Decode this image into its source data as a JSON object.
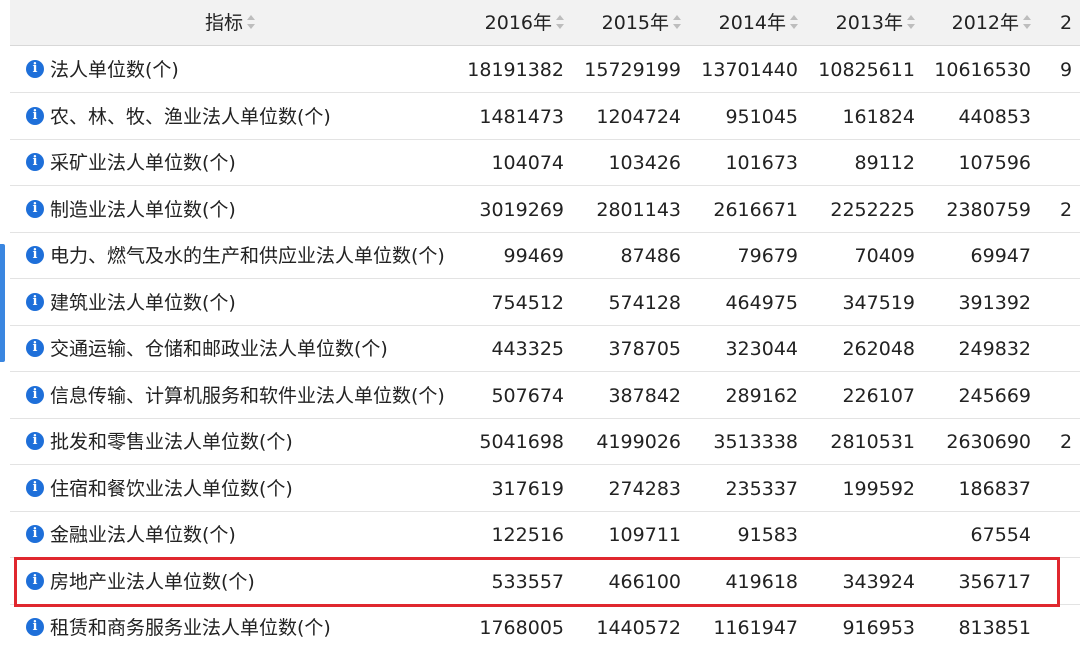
{
  "table": {
    "header": {
      "indicator": "指标",
      "years": [
        "2016年",
        "2015年",
        "2014年",
        "2013年",
        "2012年",
        "2"
      ]
    },
    "rows": [
      {
        "label": "法人单位数(个)",
        "values": [
          "18191382",
          "15729199",
          "13701440",
          "10825611",
          "10616530",
          "9"
        ]
      },
      {
        "label": "农、林、牧、渔业法人单位数(个)",
        "values": [
          "1481473",
          "1204724",
          "951045",
          "161824",
          "440853",
          ""
        ]
      },
      {
        "label": "采矿业法人单位数(个)",
        "values": [
          "104074",
          "103426",
          "101673",
          "89112",
          "107596",
          ""
        ]
      },
      {
        "label": "制造业法人单位数(个)",
        "values": [
          "3019269",
          "2801143",
          "2616671",
          "2252225",
          "2380759",
          "2"
        ]
      },
      {
        "label": "电力、燃气及水的生产和供应业法人单位数(个)",
        "values": [
          "99469",
          "87486",
          "79679",
          "70409",
          "69947",
          ""
        ]
      },
      {
        "label": "建筑业法人单位数(个)",
        "values": [
          "754512",
          "574128",
          "464975",
          "347519",
          "391392",
          ""
        ]
      },
      {
        "label": "交通运输、仓储和邮政业法人单位数(个)",
        "values": [
          "443325",
          "378705",
          "323044",
          "262048",
          "249832",
          ""
        ]
      },
      {
        "label": "信息传输、计算机服务和软件业法人单位数(个)",
        "values": [
          "507674",
          "387842",
          "289162",
          "226107",
          "245669",
          ""
        ]
      },
      {
        "label": "批发和零售业法人单位数(个)",
        "values": [
          "5041698",
          "4199026",
          "3513338",
          "2810531",
          "2630690",
          "2"
        ]
      },
      {
        "label": "住宿和餐饮业法人单位数(个)",
        "values": [
          "317619",
          "274283",
          "235337",
          "199592",
          "186837",
          ""
        ]
      },
      {
        "label": "金融业法人单位数(个)",
        "values": [
          "122516",
          "109711",
          "91583",
          "",
          "67554",
          ""
        ]
      },
      {
        "label": "房地产业法人单位数(个)",
        "values": [
          "533557",
          "466100",
          "419618",
          "343924",
          "356717",
          ""
        ]
      },
      {
        "label": "租赁和商务服务业法人单位数(个)",
        "values": [
          "1768005",
          "1440572",
          "1161947",
          "916953",
          "813851",
          ""
        ]
      }
    ],
    "highlighted_row_index": 11
  },
  "colors": {
    "info_icon": "#1e6fd9",
    "highlight_border": "#e0282e",
    "header_bg": "#f2f2f2",
    "left_tab": "#3a86e0"
  },
  "icons": {
    "row_icon": "info-icon",
    "sort_icon": "sort-icon"
  }
}
